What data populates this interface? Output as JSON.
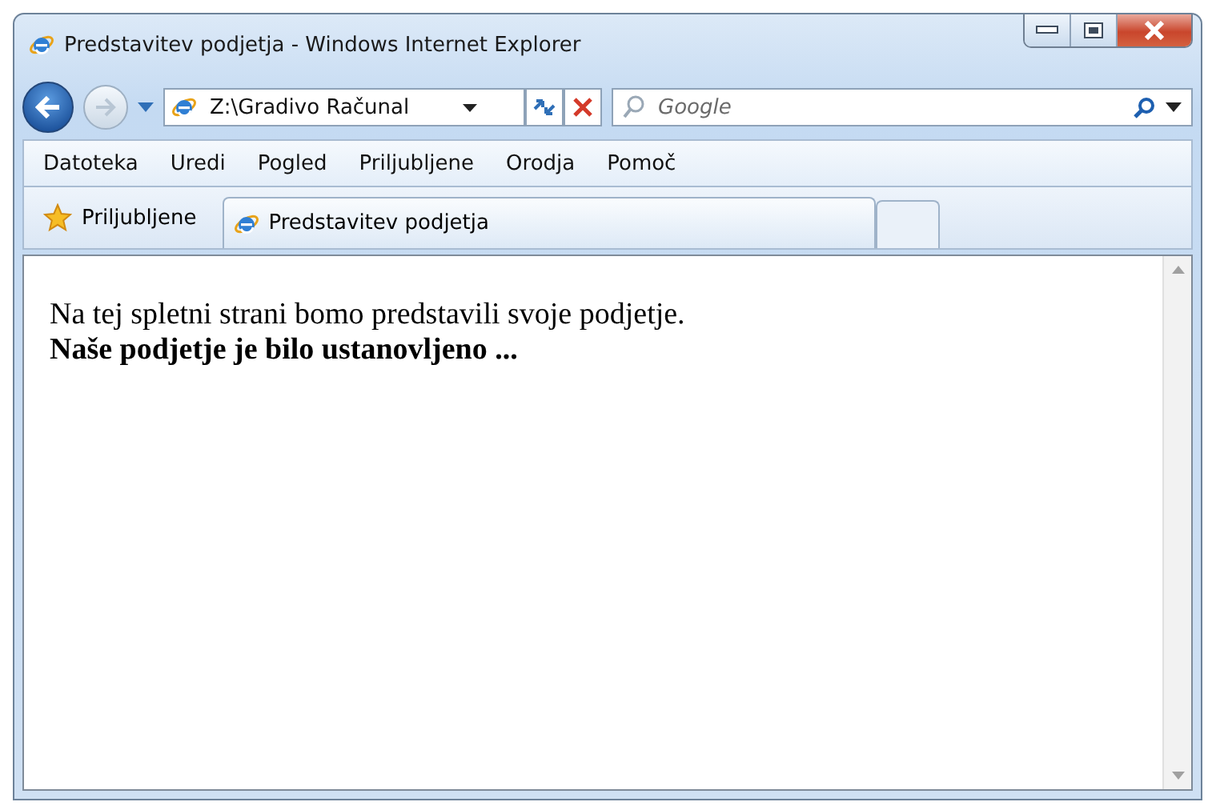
{
  "window": {
    "title": "Predstavitev podjetja - Windows Internet Explorer"
  },
  "address": {
    "value": "Z:\\Gradivo Računal"
  },
  "search": {
    "placeholder": "Google"
  },
  "menu": [
    "Datoteka",
    "Uredi",
    "Pogled",
    "Priljubljene",
    "Orodja",
    "Pomoč"
  ],
  "favorites": {
    "label": "Priljubljene"
  },
  "tabs": [
    {
      "label": "Predstavitev podjetja",
      "selected": true
    }
  ],
  "page": {
    "paragraph": "Na tej spletni strani bomo predstavili svoje podjetje.",
    "bold_line": "Naše podjetje je bilo ustanovljeno ..."
  }
}
